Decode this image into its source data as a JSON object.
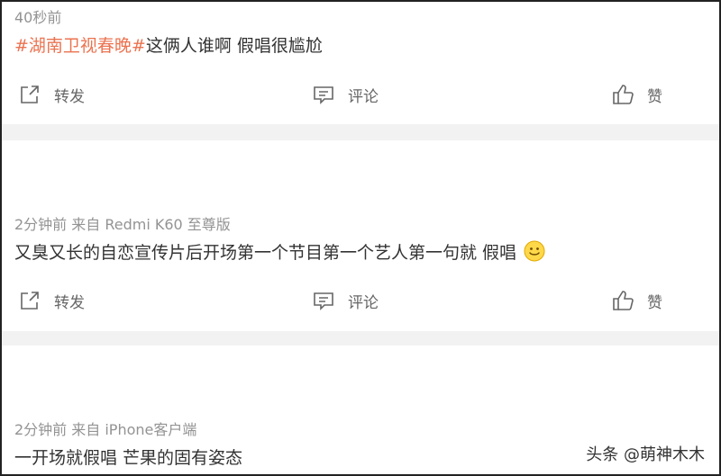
{
  "posts": [
    {
      "meta": "40秒前",
      "topic": "#湖南卫视春晚#",
      "text": "这俩人谁啊 假唱很尴尬",
      "actions": {
        "repost": "转发",
        "comment": "评论",
        "like": "赞"
      }
    },
    {
      "meta": "2分钟前  来自 Redmi K60 至尊版",
      "topic": "",
      "text": "又臭又长的自恋宣传片后开场第一个节目第一个艺人第一句就 假唱",
      "emoji": "smile-emoji",
      "actions": {
        "repost": "转发",
        "comment": "评论",
        "like": "赞"
      }
    },
    {
      "meta": "2分钟前  来自 iPhone客户端",
      "topic": "",
      "text": "一开场就假唱 芒果的固有姿态"
    }
  ],
  "watermark": "头条 @萌神木木",
  "icons": {
    "repost": "share-icon",
    "comment": "comment-icon",
    "like": "thumbs-up-icon"
  },
  "colors": {
    "topic": "#eb7350",
    "meta": "#939393",
    "divider": "#f2f2f2"
  }
}
